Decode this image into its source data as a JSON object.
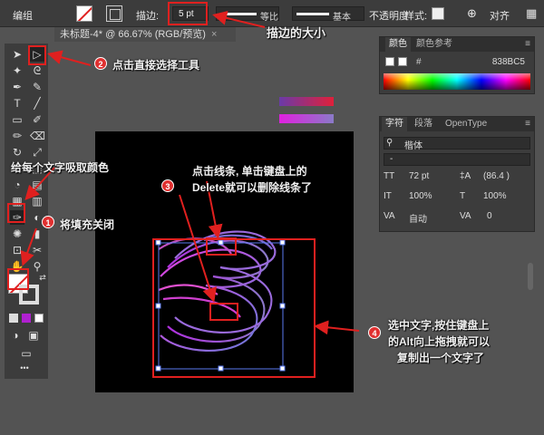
{
  "control_bar": {
    "mode_label": "编组",
    "stroke_label": "描边:",
    "stroke_value": "5 pt",
    "uniform_label": "等比",
    "basic_label": "基本",
    "opacity_label": "不透明度",
    "style_label": "样式:",
    "align_label": "对齐"
  },
  "document": {
    "tab_title": "未标题-4* @ 66.67% (RGB/预览)",
    "close": "×"
  },
  "color_panel": {
    "tab_color": "颜色",
    "tab_guide": "颜色参考",
    "hex_value": "838BC5"
  },
  "char_panel": {
    "tab_char": "字符",
    "tab_para": "段落",
    "tab_opentype": "OpenType",
    "font_family": "楷体",
    "font_style": "-",
    "font_size": "72 pt",
    "leading": "(86.4 )",
    "vscale": "100%",
    "hscale": "100%",
    "kerning": "自动",
    "tracking": "0"
  },
  "annotations": {
    "a1": "描边的大小",
    "a2": "点击直接选择工具",
    "a3_line1": "点击线条, 单击键盘上的",
    "a3_line2": "Delete就可以删除线条了",
    "a4": "给每个文字吸取颜色",
    "a5": "将填充关闭",
    "a6_line1": "选中文字,按住键盘上",
    "a6_line2": "的Alt向上拖拽就可以",
    "a6_line3": "复制出一个文字了",
    "n1": "1",
    "n2": "2",
    "n3": "3",
    "n4": "4"
  },
  "colors": {
    "annotation_red": "#e0201f",
    "gradient_top_start": "#6a3aa8",
    "gradient_top_end": "#e0203a",
    "gradient_bottom_start": "#e020e0",
    "gradient_bottom_end": "#8a7ac8"
  }
}
